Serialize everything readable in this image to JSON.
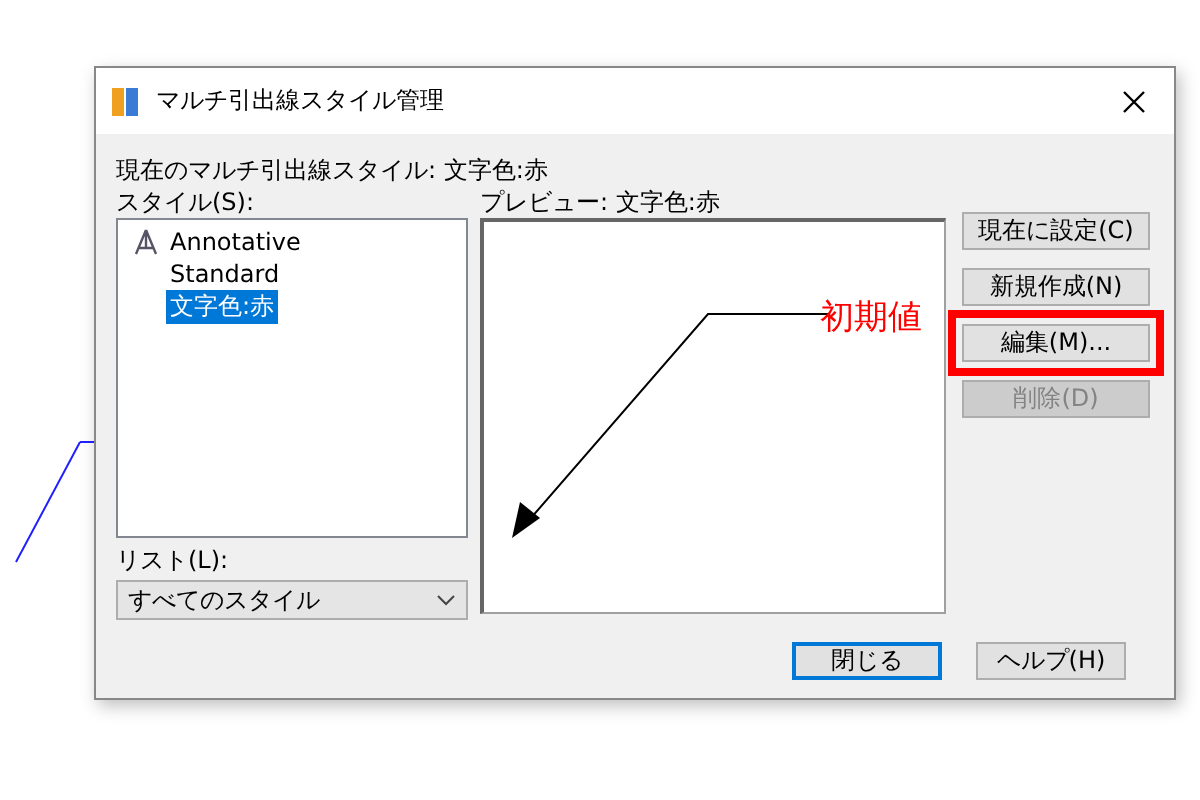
{
  "window": {
    "title": "マルチ引出線スタイル管理"
  },
  "current_style": "現在のマルチ引出線スタイル: 文字色:赤",
  "styles": {
    "label": "スタイル(S):",
    "items": [
      {
        "name": "Annotative",
        "annotative": true,
        "selected": false
      },
      {
        "name": "Standard",
        "annotative": false,
        "selected": false
      },
      {
        "name": "文字色:赤",
        "annotative": false,
        "selected": true
      }
    ]
  },
  "list_filter": {
    "label": "リスト(L):",
    "value": "すべてのスタイル"
  },
  "preview": {
    "label": "プレビュー: 文字色:赤",
    "text": "初期値"
  },
  "buttons": [
    {
      "label": "現在に設定(C)",
      "disabled": false,
      "highlighted": false
    },
    {
      "label": "新規作成(N)",
      "disabled": false,
      "highlighted": false
    },
    {
      "label": "編集(M)...",
      "disabled": false,
      "highlighted": true
    },
    {
      "label": "削除(D)",
      "disabled": true,
      "highlighted": false
    }
  ],
  "footer_buttons": [
    {
      "label": "閉じる",
      "default": true
    },
    {
      "label": "ヘルプ(H)",
      "default": false
    }
  ]
}
